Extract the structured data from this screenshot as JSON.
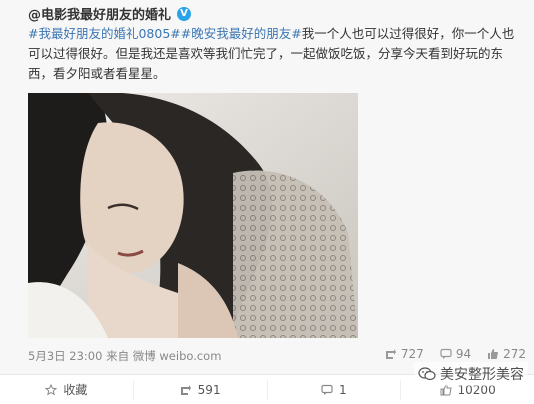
{
  "post": {
    "author": "@电影我最好朋友的婚礼",
    "verified_icon": "verified-v-icon",
    "text_tag1": "#我最好朋友的婚礼0805#",
    "text_tag2": "#晚安我最好的朋友#",
    "text_body": "我一个人也可以过得很好，你一个人也可以过得很好。但是我还是喜欢等我们忙完了，一起做饭吃饭，分享今天看到好玩的东西，看夕阳或者看星星。",
    "meta": "5月3日 23:00 来自 微博 weibo.com",
    "stats": {
      "reposts": "727",
      "comments": "94",
      "likes": "272"
    }
  },
  "actions": {
    "favorite": "收藏",
    "repost": "591",
    "comment": "1",
    "like": "10200"
  },
  "watermark": {
    "text": "美安整形美容",
    "icon": "wechat-icon"
  },
  "colors": {
    "tag": "#3b76b3",
    "verified": "#2aa4e8"
  }
}
